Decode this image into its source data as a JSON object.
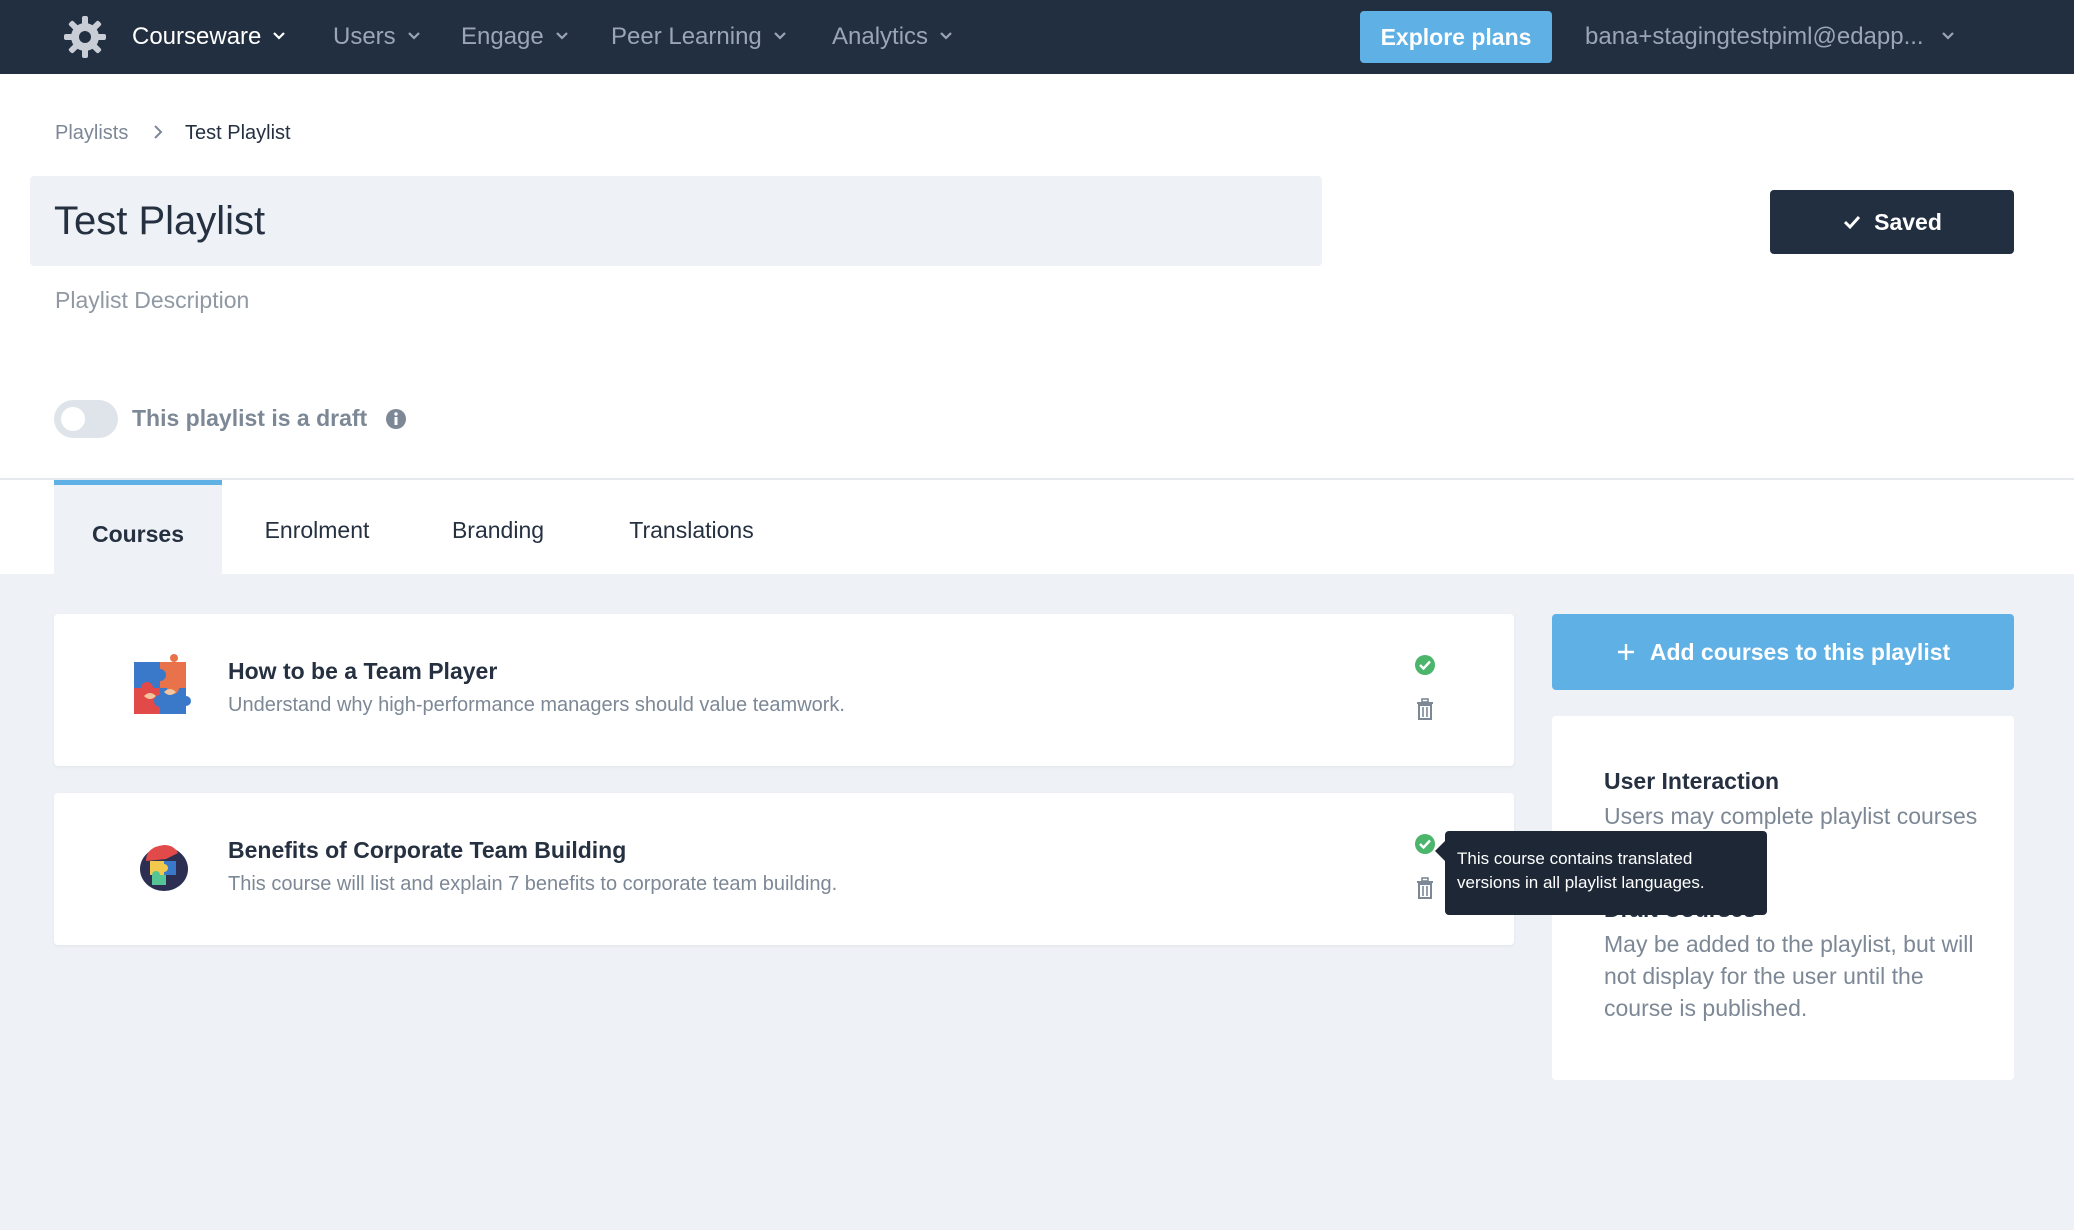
{
  "nav": {
    "logo_icon": "gear-logo-icon",
    "items": [
      {
        "label": "Courseware",
        "active": true
      },
      {
        "label": "Users"
      },
      {
        "label": "Engage"
      },
      {
        "label": "Peer Learning"
      },
      {
        "label": "Analytics"
      }
    ],
    "explore_label": "Explore plans",
    "user_email": "bana+stagingtestpiml@edapp..."
  },
  "breadcrumb": {
    "parent": "Playlists",
    "current": "Test Playlist"
  },
  "playlist": {
    "title": "Test Playlist",
    "description_placeholder": "Playlist Description",
    "draft_label": "This playlist is a draft",
    "draft_enabled": false,
    "save_status": "Saved"
  },
  "tabs": [
    {
      "label": "Courses",
      "active": true
    },
    {
      "label": "Enrolment"
    },
    {
      "label": "Branding"
    },
    {
      "label": "Translations"
    }
  ],
  "courses": [
    {
      "title": "How to be a Team Player",
      "description": "Understand why high-performance managers should value teamwork.",
      "thumbnail_icon": "puzzle-pieces-icon"
    },
    {
      "title": "Benefits of Corporate Team Building",
      "description": "This course will list and explain 7 benefits to corporate team building.",
      "thumbnail_icon": "puzzle-head-icon"
    }
  ],
  "tooltip": "This course contains translated versions in all playlist languages.",
  "sidebar": {
    "add_button": "Add courses to this playlist",
    "user_interaction_title": "User Interaction",
    "user_interaction_text": "Users may complete playlist courses in any order.",
    "draft_courses_title": "Draft Courses",
    "draft_courses_text": "May be added to the playlist, but will not display for the user until the course is published."
  },
  "colors": {
    "nav_bg": "#212f41",
    "accent": "#5fb0e5",
    "success": "#4bb56b",
    "page_bg": "#eef2f7"
  }
}
